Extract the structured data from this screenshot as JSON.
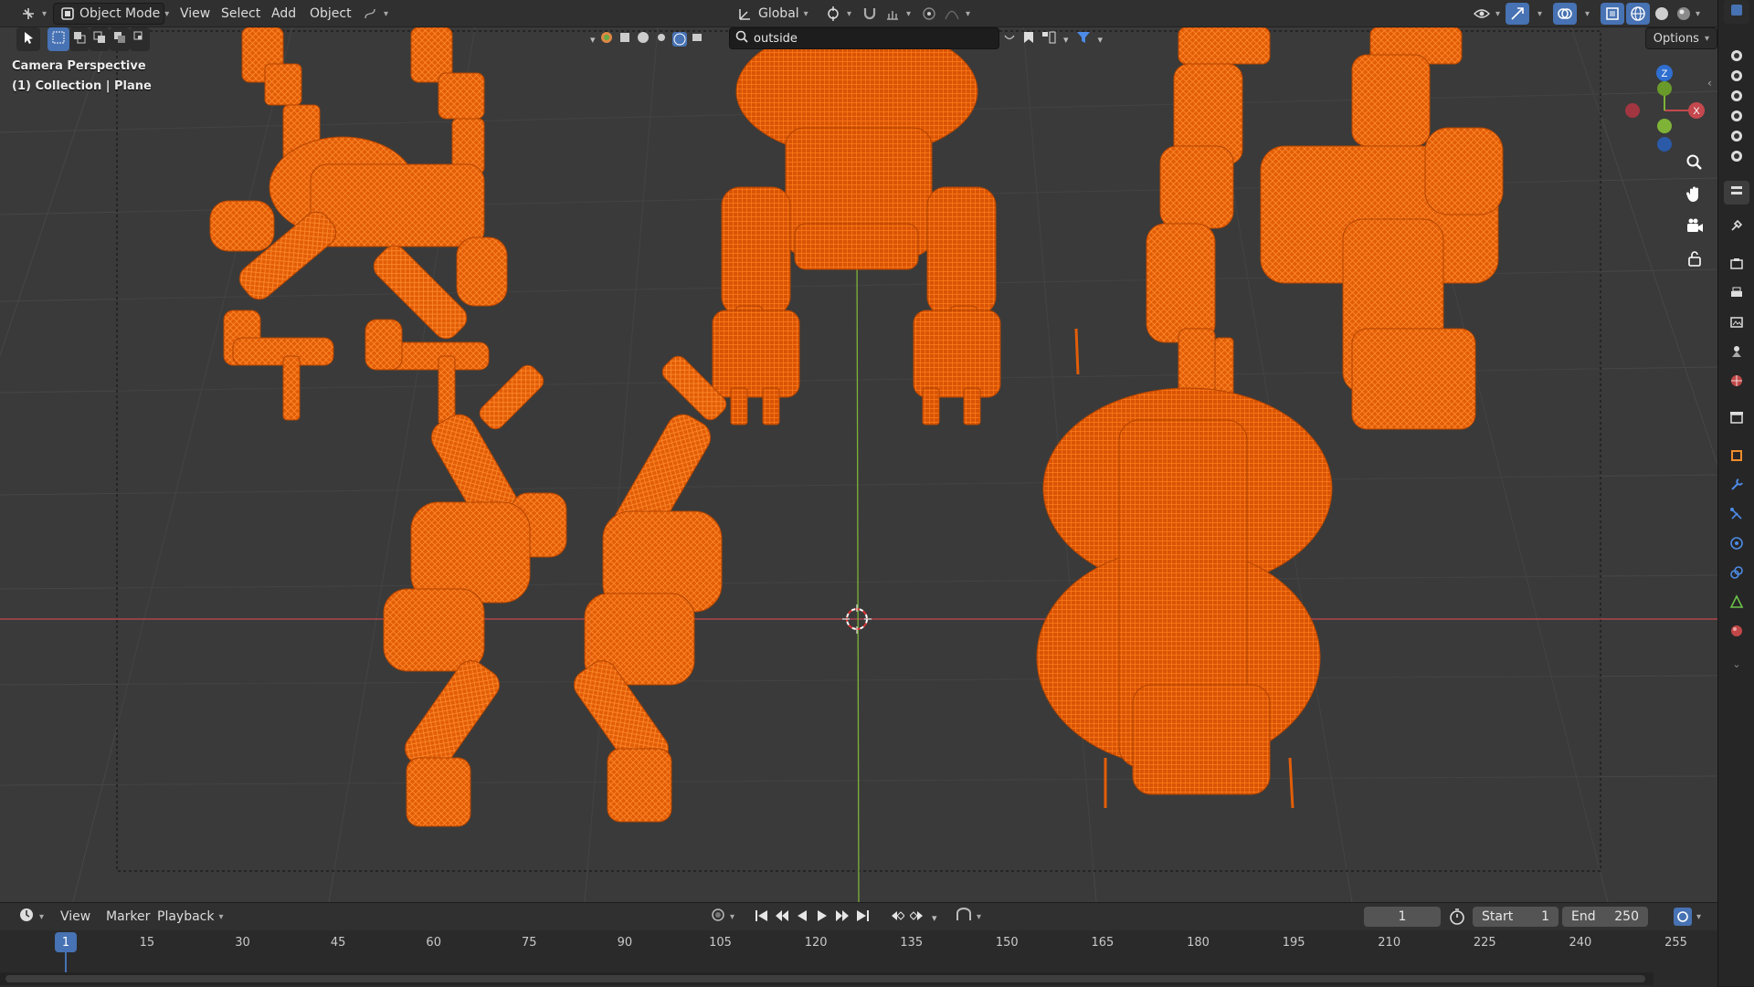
{
  "header": {
    "mode": "Object Mode",
    "menus": [
      "View",
      "Select",
      "Add",
      "Object"
    ],
    "transform_orientation": "Global"
  },
  "viewport": {
    "overlay_title": "Camera Perspective",
    "overlay_subtitle": "(1) Collection | Plane",
    "search_value": "outside",
    "options_label": "Options",
    "gizmo": {
      "z": "Z",
      "x": "X"
    }
  },
  "colors": {
    "accent": "#4772b3",
    "wire": "#ff6a00",
    "x_axis": "#c4484e",
    "y_axis": "#7eb338"
  },
  "timeline": {
    "menus": [
      "View",
      "Marker",
      "Playback"
    ],
    "current_frame": "1",
    "start_label": "Start",
    "start_value": "1",
    "end_label": "End",
    "end_value": "250",
    "ticks": [
      "1",
      "15",
      "30",
      "45",
      "60",
      "75",
      "90",
      "105",
      "120",
      "135",
      "150",
      "165",
      "180",
      "195",
      "210",
      "225",
      "240",
      "255"
    ]
  }
}
